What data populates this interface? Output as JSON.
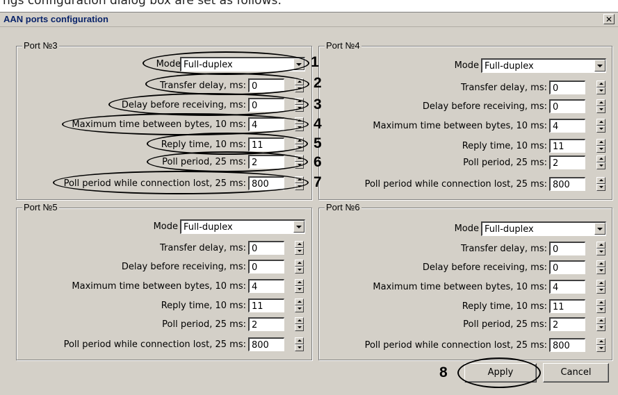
{
  "background_strip": {
    "text": "ngs configuration dialog box are set as follows:"
  },
  "window": {
    "title": "AAN ports configuration",
    "close_label": "✕"
  },
  "ports": [
    {
      "title": "Port №3",
      "mode": {
        "label": "Mode",
        "value": "Full-duplex"
      },
      "fields": [
        {
          "label": "Transfer delay, ms:",
          "value": "0"
        },
        {
          "label": "Delay before receiving, ms:",
          "value": "0"
        },
        {
          "label": "Maximum time between bytes, 10 ms:",
          "value": "4"
        },
        {
          "label": "Reply time, 10 ms:",
          "value": "11"
        },
        {
          "label": "Poll period, 25 ms:",
          "value": "2"
        },
        {
          "label": "Poll period while connection lost, 25 ms:",
          "value": "800"
        }
      ]
    },
    {
      "title": "Port №4",
      "mode": {
        "label": "Mode",
        "value": "Full-duplex"
      },
      "fields": [
        {
          "label": "Transfer delay, ms:",
          "value": "0"
        },
        {
          "label": "Delay before receiving, ms:",
          "value": "0"
        },
        {
          "label": "Maximum time between bytes, 10 ms:",
          "value": "4"
        },
        {
          "label": "Reply time, 10 ms:",
          "value": "11"
        },
        {
          "label": "Poll period, 25 ms:",
          "value": "2"
        },
        {
          "label": "Poll period while connection lost, 25 ms:",
          "value": "800"
        }
      ]
    },
    {
      "title": "Port №5",
      "mode": {
        "label": "Mode",
        "value": "Full-duplex"
      },
      "fields": [
        {
          "label": "Transfer delay, ms:",
          "value": "0"
        },
        {
          "label": "Delay before receiving, ms:",
          "value": "0"
        },
        {
          "label": "Maximum time between bytes, 10 ms:",
          "value": "4"
        },
        {
          "label": "Reply time, 10 ms:",
          "value": "11"
        },
        {
          "label": "Poll period, 25 ms:",
          "value": "2"
        },
        {
          "label": "Poll period while connection lost, 25 ms:",
          "value": "800"
        }
      ]
    },
    {
      "title": "Port №6",
      "mode": {
        "label": "Mode",
        "value": "Full-duplex"
      },
      "fields": [
        {
          "label": "Transfer delay, ms:",
          "value": "0"
        },
        {
          "label": "Delay before receiving, ms:",
          "value": "0"
        },
        {
          "label": "Maximum time between bytes, 10 ms:",
          "value": "4"
        },
        {
          "label": "Reply time, 10 ms:",
          "value": "11"
        },
        {
          "label": "Poll period, 25 ms:",
          "value": "2"
        },
        {
          "label": "Poll period while connection lost, 25 ms:",
          "value": "800"
        }
      ]
    }
  ],
  "callouts": [
    "1",
    "2",
    "3",
    "4",
    "5",
    "6",
    "7",
    "8"
  ],
  "buttons": {
    "apply": "Apply",
    "cancel": "Cancel"
  }
}
